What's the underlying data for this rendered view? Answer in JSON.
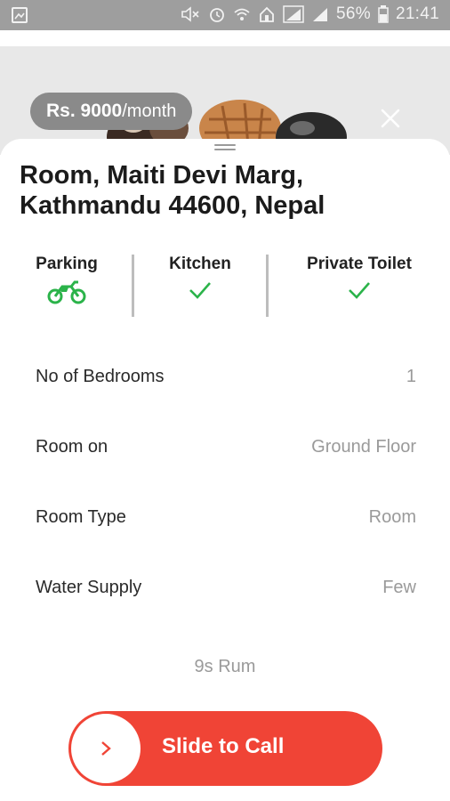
{
  "status_bar": {
    "battery": "56%",
    "time": "21:41",
    "icons": [
      "gallery-icon",
      "mute-icon",
      "alarm-icon",
      "wifi-icon",
      "home-icon",
      "signal-icon",
      "signal-icon",
      "battery-icon"
    ]
  },
  "hero": {
    "price_amount": "Rs. 9000",
    "price_unit": "/month",
    "close_icon": "close-icon"
  },
  "listing": {
    "title": "Room, Maiti Devi Marg, Kathmandu 44600, Nepal"
  },
  "amenities": [
    {
      "label": "Parking",
      "icon": "motorbike-icon"
    },
    {
      "label": "Kitchen",
      "icon": "check-icon"
    },
    {
      "label": "Private Toilet",
      "icon": "check-icon"
    }
  ],
  "details": [
    {
      "label": "No of Bedrooms",
      "value": "1"
    },
    {
      "label": "Room on",
      "value": "Ground Floor"
    },
    {
      "label": "Room Type",
      "value": "Room"
    },
    {
      "label": "Water Supply",
      "value": "Few"
    }
  ],
  "hint": "9s Rum",
  "call": {
    "label": "Slide to Call",
    "knob_icon": "chevron-right-icon"
  },
  "colors": {
    "accent": "#f04436",
    "amenity_green": "#2bb34a",
    "status_bar": "#9e9e9e"
  }
}
